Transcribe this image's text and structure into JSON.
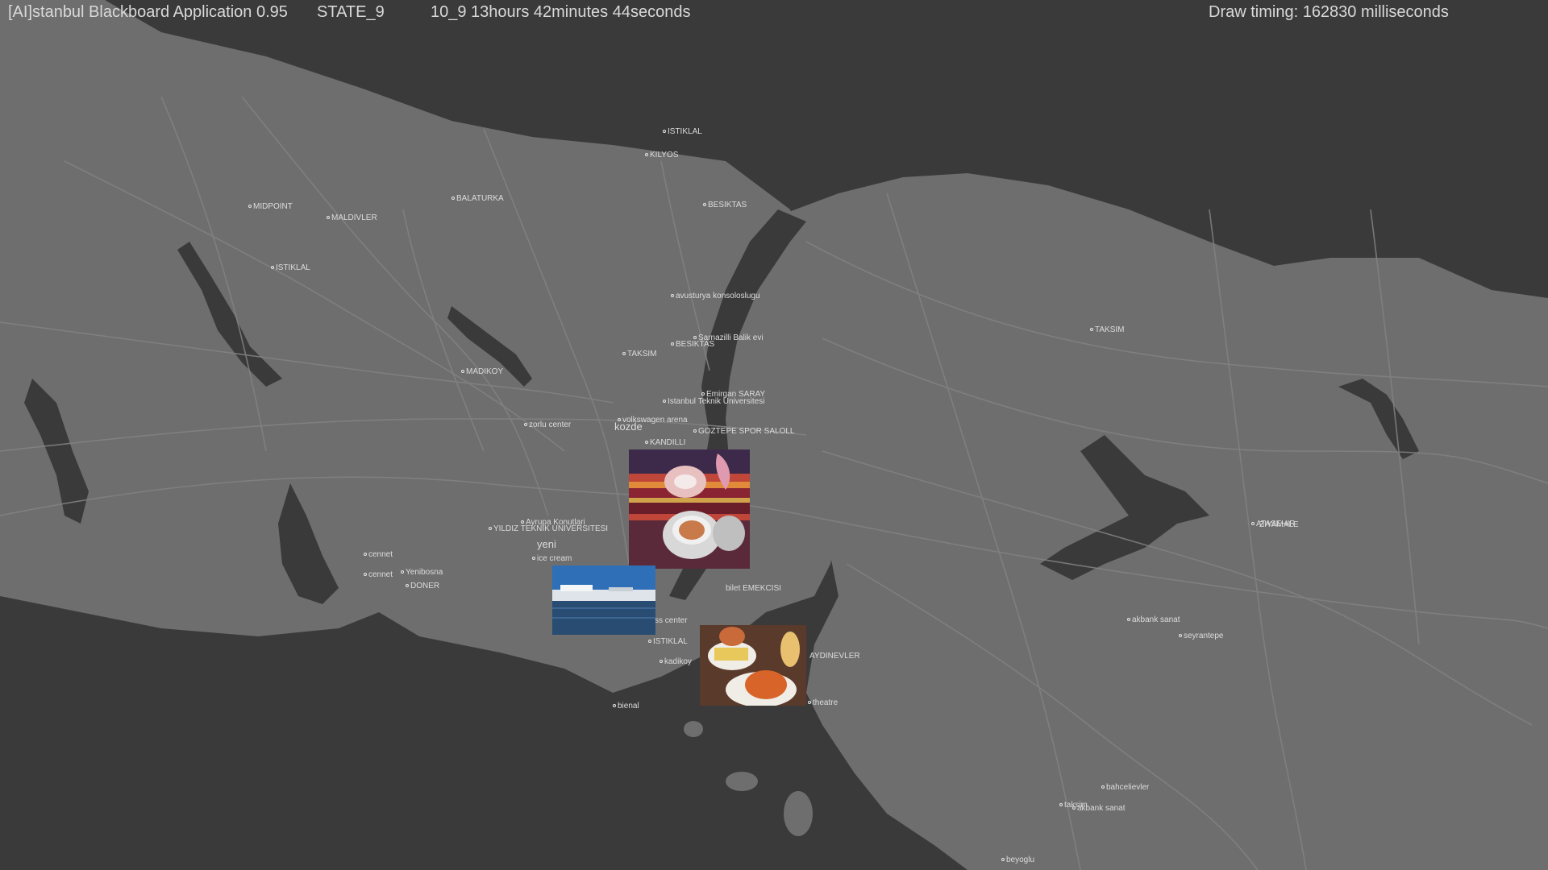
{
  "hud": {
    "app_title": "[AI]stanbul Blackboard Application 0.95",
    "state": "STATE_9",
    "clock": "10_9  13hours 42minutes 44seconds",
    "draw_timing": "Draw timing: 162830 milliseconds"
  },
  "colors": {
    "background": "#3a3a3a",
    "land": "#6f6f6f",
    "water": "#3a3a3a",
    "roads": "#838383",
    "label": "#dcdcdc"
  },
  "places": [
    "ISTIKLAL",
    "KILYOS",
    "BALATURKA",
    "BESIKTAS",
    "MIDPOINT",
    "MALDIVLER",
    "ISTIKLAL",
    "avusturya konsoloslugu",
    "TAKSIM",
    "BESIKTAS",
    "Sarnazilli Balik evi",
    "MADIKOY",
    "TAKSIM",
    "Istanbul Teknik Universitesi",
    "Emirgan SARAY",
    "zorlu center",
    "volkswagen arena",
    "kozde",
    "KANDILLI",
    "GOZTEPE SPOR SALOLL",
    "Ayrupa Konutlari",
    "YILDIZ TEKNIK UNIVERSITESI",
    "yeni",
    "cennet",
    "Yenibosna",
    "cennet",
    "DONER",
    "ice cream",
    "bilet EMEKCISI",
    "ss center",
    "ISTIKLAL",
    "kadikoy",
    "bienal",
    "AYDINEVLER",
    "theatre",
    "akbank sanat",
    "seyrantepe",
    "ATASEHIR",
    "ZIYAMALE",
    "bahcelievler",
    "akbank sanat",
    "beyoglu",
    "taksim"
  ],
  "photos": [
    {
      "subject": "turkish-coffee-photo"
    },
    {
      "subject": "waterfront-photo"
    },
    {
      "subject": "food-plate-photo"
    }
  ]
}
